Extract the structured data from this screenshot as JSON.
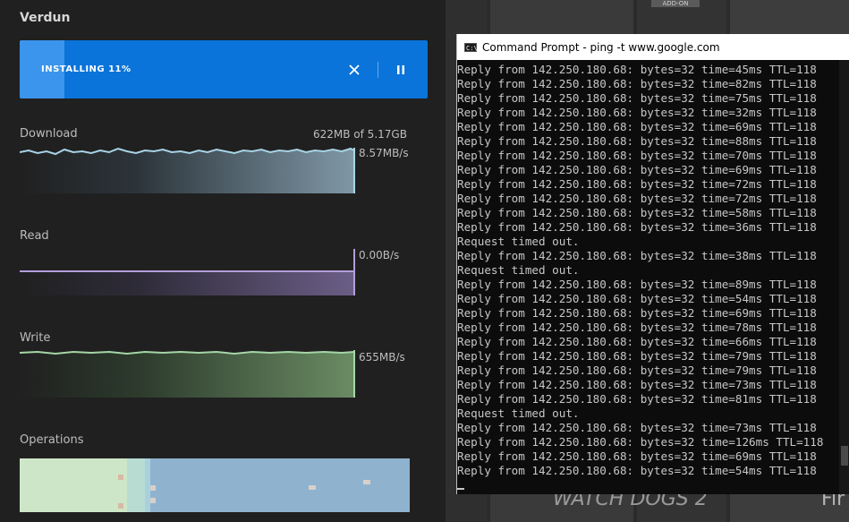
{
  "launcher": {
    "game_title": "Verdun",
    "install": {
      "label": "INSTALLING 11%",
      "progress": 0.11
    },
    "download": {
      "label": "Download",
      "total": "622MB of 5.17GB",
      "rate": "8.57MB/s"
    },
    "read": {
      "label": "Read",
      "rate": "0.00B/s"
    },
    "write": {
      "label": "Write",
      "rate": "655MB/s"
    },
    "operations": {
      "label": "Operations"
    }
  },
  "background": {
    "addon_badge": "ADD-ON",
    "tile_text": "WATCH DOGS 2",
    "tile_text_right": "Fir"
  },
  "cmd": {
    "title": "Command Prompt - ping  -t www.google.com",
    "lines": [
      "Reply from 142.250.180.68: bytes=32 time=45ms TTL=118",
      "Reply from 142.250.180.68: bytes=32 time=82ms TTL=118",
      "Reply from 142.250.180.68: bytes=32 time=75ms TTL=118",
      "Reply from 142.250.180.68: bytes=32 time=32ms TTL=118",
      "Reply from 142.250.180.68: bytes=32 time=69ms TTL=118",
      "Reply from 142.250.180.68: bytes=32 time=88ms TTL=118",
      "Reply from 142.250.180.68: bytes=32 time=70ms TTL=118",
      "Reply from 142.250.180.68: bytes=32 time=69ms TTL=118",
      "Reply from 142.250.180.68: bytes=32 time=72ms TTL=118",
      "Reply from 142.250.180.68: bytes=32 time=72ms TTL=118",
      "Reply from 142.250.180.68: bytes=32 time=58ms TTL=118",
      "Reply from 142.250.180.68: bytes=32 time=36ms TTL=118",
      "Request timed out.",
      "Reply from 142.250.180.68: bytes=32 time=38ms TTL=118",
      "Request timed out.",
      "Reply from 142.250.180.68: bytes=32 time=89ms TTL=118",
      "Reply from 142.250.180.68: bytes=32 time=54ms TTL=118",
      "Reply from 142.250.180.68: bytes=32 time=69ms TTL=118",
      "Reply from 142.250.180.68: bytes=32 time=78ms TTL=118",
      "Reply from 142.250.180.68: bytes=32 time=66ms TTL=118",
      "Reply from 142.250.180.68: bytes=32 time=79ms TTL=118",
      "Reply from 142.250.180.68: bytes=32 time=79ms TTL=118",
      "Reply from 142.250.180.68: bytes=32 time=73ms TTL=118",
      "Reply from 142.250.180.68: bytes=32 time=81ms TTL=118",
      "Request timed out.",
      "Reply from 142.250.180.68: bytes=32 time=73ms TTL=118",
      "Reply from 142.250.180.68: bytes=32 time=126ms TTL=118",
      "Reply from 142.250.180.68: bytes=32 time=69ms TTL=118",
      "Reply from 142.250.180.68: bytes=32 time=54ms TTL=118"
    ]
  },
  "colors": {
    "install_blue": "#0a74da",
    "download_line": "#a8d4e6",
    "read_line": "#b39ddb",
    "write_line": "#a5d6a7"
  }
}
